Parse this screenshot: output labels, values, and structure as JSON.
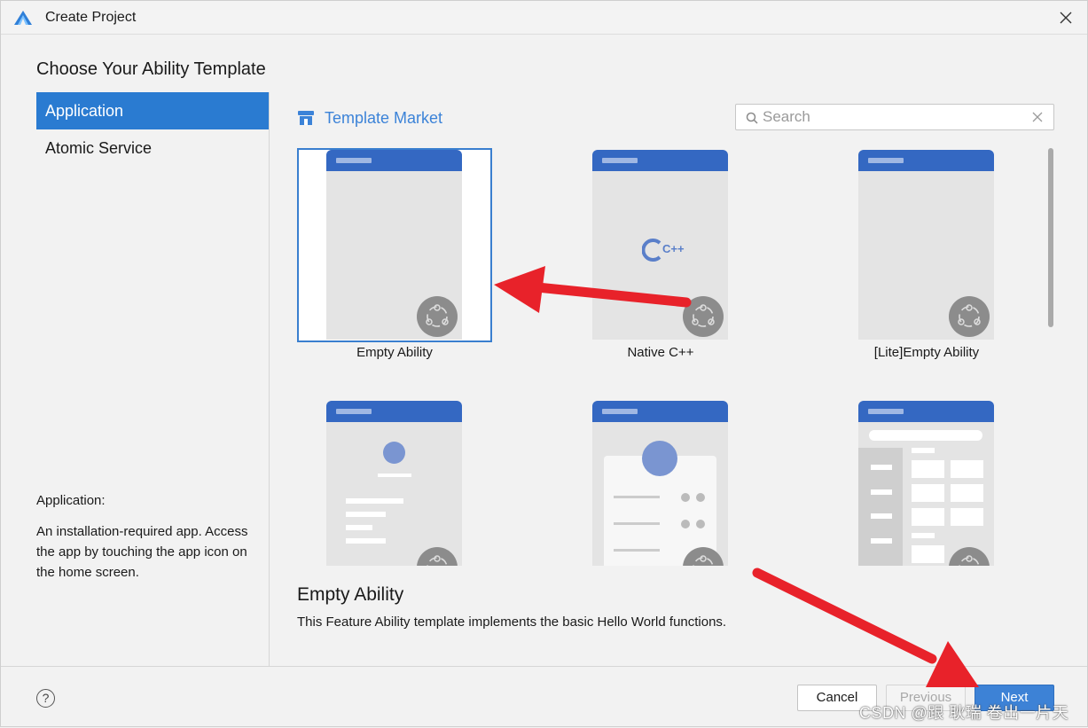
{
  "window": {
    "title": "Create Project"
  },
  "heading": "Choose Your Ability Template",
  "sidebar": {
    "items": [
      {
        "label": "Application",
        "active": true
      },
      {
        "label": "Atomic Service",
        "active": false
      }
    ],
    "description": {
      "title": "Application:",
      "body": "An installation-required app. Access the app by touching the app icon on the home screen."
    }
  },
  "market": {
    "label": "Template Market",
    "icon": "store-icon"
  },
  "search": {
    "placeholder": "Search",
    "value": ""
  },
  "templates": [
    {
      "name": "Empty Ability",
      "selected": true
    },
    {
      "name": "Native C++",
      "selected": false
    },
    {
      "name": "[Lite]Empty Ability",
      "selected": false
    },
    {
      "name": "",
      "selected": false
    },
    {
      "name": "",
      "selected": false
    },
    {
      "name": "",
      "selected": false
    }
  ],
  "native_logo": "C++",
  "selected_template": {
    "name": "Empty Ability",
    "description": "This Feature Ability template implements the basic Hello World functions."
  },
  "footer": {
    "help": "?",
    "cancel": "Cancel",
    "previous": "Previous",
    "next": "Next"
  },
  "watermark": "CSDN @跟 耿瑞 卷出一片天",
  "colors": {
    "accent": "#2a7bd1",
    "template_bar": "#3468c2",
    "arrow": "#e8222a"
  }
}
